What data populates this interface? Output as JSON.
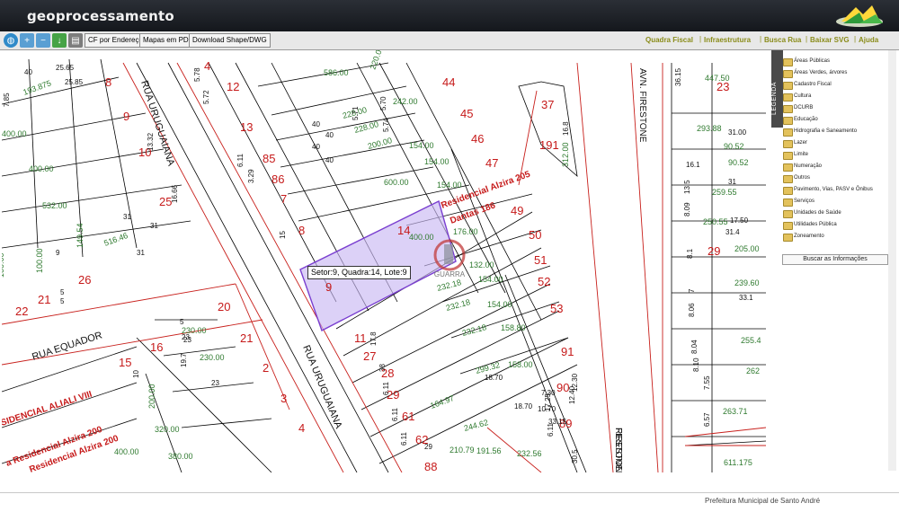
{
  "header": {
    "app_title": "geoprocessamento",
    "links": [
      "Quadra Fiscal",
      "Infraestrutura",
      "Busca Rua",
      "Baixar SVG",
      "Ajuda"
    ]
  },
  "toolbar": {
    "icons": [
      "globe-icon",
      "zoom-in-icon",
      "zoom-out-icon",
      "download-icon",
      "print-icon"
    ],
    "buttons": [
      "CF por Endereço",
      "Mapas em PDF",
      "Download Shape/DWG"
    ]
  },
  "popup": {
    "text": "Setor:9, Quadra:14, Lote:9"
  },
  "watermark": {
    "text": "GUARRA"
  },
  "legend": {
    "tab_label": "LEGENDA",
    "items": [
      "Áreas Públicas",
      "Áreas Verdes, árvores",
      "Cadastro Fiscal",
      "Cultura",
      "DCURB",
      "Educação",
      "Hidrografia e Saneamento",
      "Lazer",
      "Limite",
      "Numeração",
      "Outros",
      "Pavimento, Vias, PASV e Ônibus",
      "Serviços",
      "Unidades de Saúde",
      "Utilidades Pública",
      "Zoneamento"
    ],
    "search_button": "Buscar as Informações"
  },
  "footer": {
    "label": "Prefeitura Municipal de Santo André"
  },
  "map": {
    "streets": [
      "RUA URUGUAIANA",
      "RUA URUGUAIANA",
      "RUA EQUADOR",
      "AVN. FIRESTONE",
      "FIRESTONE",
      "RESTONE"
    ],
    "lot_numbers_red": [
      "4",
      "12",
      "13",
      "85",
      "86",
      "7",
      "8",
      "9",
      "11",
      "27",
      "28",
      "29",
      "61",
      "62",
      "88",
      "14",
      "44",
      "45",
      "46",
      "47",
      "49",
      "50",
      "51",
      "52",
      "53",
      "91",
      "90",
      "89",
      "37",
      "191",
      "23",
      "29",
      "8",
      "9",
      "10",
      "25",
      "26",
      "21",
      "22",
      "20",
      "21",
      "16",
      "15",
      "2",
      "3",
      "4"
    ],
    "measurements_green": [
      "586.00",
      "220.00",
      "242.00",
      "228.00",
      "228.00",
      "200.00",
      "154.00",
      "154.00",
      "154.00",
      "600.00",
      "400.00",
      "176.00",
      "132.00",
      "154.00",
      "232.18",
      "232.18",
      "154.00",
      "232.18",
      "158.80",
      "299.32",
      "158.00",
      "164.97",
      "244.62",
      "210.79",
      "191.56",
      "232.56",
      "193.875",
      "400.00",
      "400.00",
      "532.00",
      "516.46",
      "100.00",
      "100.00",
      "149.54",
      "230.00",
      "230.00",
      "200.00",
      "320.00",
      "400.00",
      "380.00",
      "447.50",
      "293.88",
      "90.52",
      "90.52",
      "259.55",
      "250.55",
      "205.00",
      "239.60",
      "255.4",
      "262",
      "263.71",
      "611.175",
      "312.00",
      "400.00"
    ],
    "measurements_black": [
      "40",
      "25.65",
      "7.85",
      "25.85",
      "40",
      "40",
      "40",
      "40",
      "31",
      "31",
      "31",
      "13.32",
      "16.66",
      "15",
      "9",
      "5",
      "5",
      "5",
      "23",
      "23",
      "23",
      "10",
      "19.7",
      "16.8",
      "36.15",
      "16.1",
      "13.5",
      "8.09",
      "8.1",
      "7",
      "8.06",
      "8.04",
      "8.10",
      "7.55",
      "6.57",
      "17.50",
      "31.4",
      "33.1",
      "31.00",
      "31",
      "29",
      "30.5",
      "17.25",
      "12.30",
      "12.40",
      "10.70",
      "7.30",
      "18.70",
      "18.70",
      "33.15",
      "17.8",
      "38",
      "6.11",
      "6.11",
      "6.11",
      "6.11",
      "6.11",
      "3.29",
      "5.71",
      "5.70",
      "5.74",
      "5.72",
      "5.78",
      "6.3",
      "8"
    ],
    "labels_red_text": [
      "SIDENCIAL ALIALI VIII",
      "a Residencial Alzira 200",
      "Residencial Alzira 200",
      "Dantas 186",
      "Residencial Alzira 205"
    ]
  }
}
